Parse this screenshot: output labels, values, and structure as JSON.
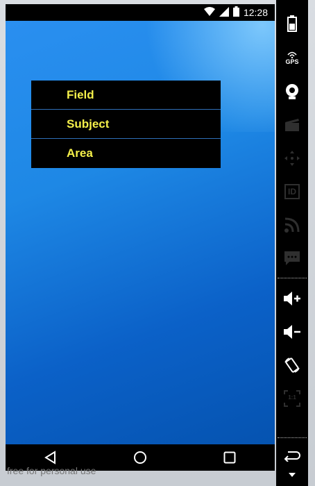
{
  "status_bar": {
    "time": "12:28"
  },
  "menu": {
    "items": [
      {
        "label": "Field"
      },
      {
        "label": "Subject"
      },
      {
        "label": "Area"
      }
    ]
  },
  "watermark": "free for personal use",
  "sidebar": {
    "gps_label": "GPS",
    "id_label": "ID",
    "ratio_label": "1:1"
  },
  "colors": {
    "menu_text": "#f5f04a",
    "menu_bg": "#000000",
    "screen_bg": "#1e88e5"
  }
}
